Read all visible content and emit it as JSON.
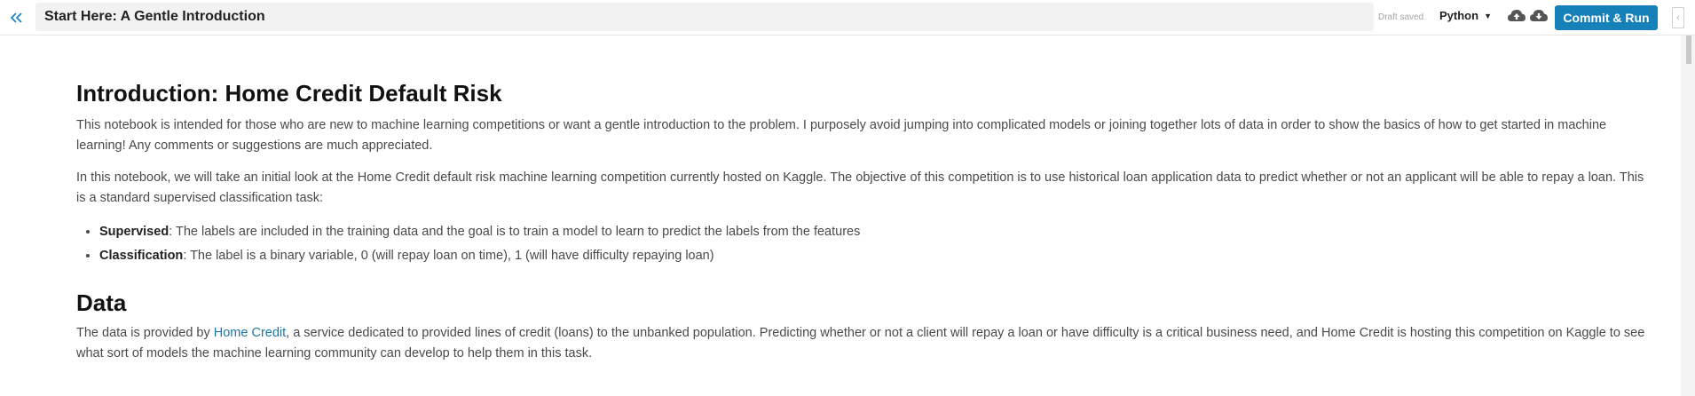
{
  "header": {
    "notebook_title": "Start Here: A Gentle Introduction",
    "draft_status": "Draft saved",
    "language": "Python",
    "commit_label": "Commit & Run",
    "icons": {
      "collapse": "double-chevron-left-icon",
      "upload": "cloud-upload-icon",
      "download": "cloud-download-icon",
      "side_toggle": "chevron-left-icon"
    },
    "colors": {
      "accent": "#1681b8",
      "collapse_icon": "#1e88c7"
    }
  },
  "content": {
    "intro_heading": "Introduction: Home Credit Default Risk",
    "intro_paragraph_1": "This notebook is intended for those who are new to machine learning competitions or want a gentle introduction to the problem. I purposely avoid jumping into complicated models or joining together lots of data in order to show the basics of how to get started in machine learning! Any comments or suggestions are much appreciated.",
    "intro_paragraph_2": "In this notebook, we will take an initial look at the Home Credit default risk machine learning competition currently hosted on Kaggle. The objective of this competition is to use historical loan application data to predict whether or not an applicant will be able to repay a loan. This is a standard supervised classification task:",
    "bullets": [
      {
        "term": "Supervised",
        "text": ": The labels are included in the training data and the goal is to train a model to learn to predict the labels from the features"
      },
      {
        "term": "Classification",
        "text": ": The label is a binary variable, 0 (will repay loan on time), 1 (will have difficulty repaying loan)"
      }
    ],
    "data_heading": "Data",
    "data_paragraph_prefix": "The data is provided by ",
    "data_link_text": "Home Credit",
    "data_paragraph_suffix": ", a service dedicated to provided lines of credit (loans) to the unbanked population. Predicting whether or not a client will repay a loan or have difficulty is a critical business need, and Home Credit is hosting this competition on Kaggle to see what sort of models the machine learning community can develop to help them in this task."
  }
}
